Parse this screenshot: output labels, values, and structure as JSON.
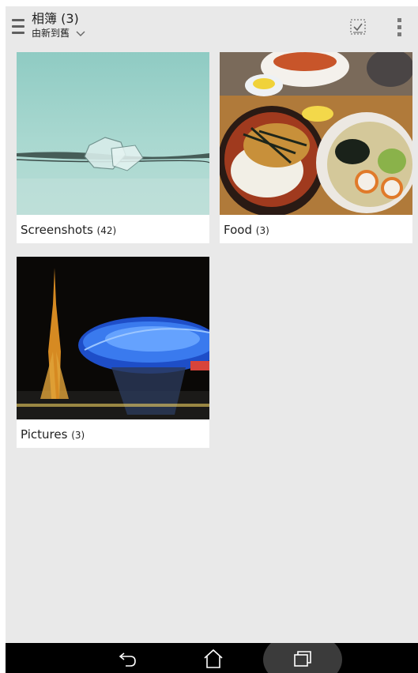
{
  "header": {
    "title": "相簿 (3)",
    "sort_label": "由新到舊"
  },
  "albums": [
    {
      "name": "Screenshots",
      "count": "(42)"
    },
    {
      "name": "Food",
      "count": "(3)"
    },
    {
      "name": "Pictures",
      "count": "(3)"
    }
  ],
  "colors": {
    "background": "#e9e9e9",
    "card": "#ffffff",
    "navbar": "#000000"
  },
  "icons": [
    "hamburger-menu-icon",
    "chevron-down-icon",
    "select-all-icon",
    "more-options-icon",
    "back-icon",
    "home-icon",
    "recent-apps-icon"
  ]
}
